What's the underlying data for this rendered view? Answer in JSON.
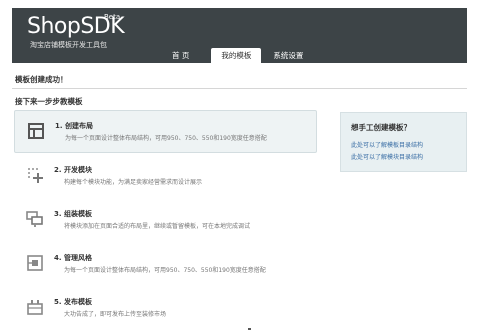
{
  "header": {
    "logo": "ShopSDK",
    "beta": "Beta",
    "tagline": "淘宝店铺模板开发工具包",
    "tabs": [
      {
        "label": "首 页"
      },
      {
        "label": "我的模板"
      },
      {
        "label": "系统设置"
      }
    ],
    "active_tab": "我的模板"
  },
  "main": {
    "success_message": "模板创建成功！",
    "next_steps_title": "接下来一步步教模板",
    "steps": [
      {
        "title": "1. 创建布局",
        "desc": "为每一个页面设计整体布局结构，可用950、750、550和190宽度任意搭配",
        "icon": "layout-icon"
      },
      {
        "title": "2. 开发模块",
        "desc": "构建每个模块功能，为满足卖家经营需求而设计展示",
        "icon": "add-module-icon"
      },
      {
        "title": "3. 组装模板",
        "desc": "将模块添加在页面合适的布局里，继续或暂留模板，可在本地完成调试",
        "icon": "assemble-icon"
      },
      {
        "title": "4. 管理风格",
        "desc": "为每一个页面设计整体布局结构，可用950、750、550和190宽度任意搭配",
        "icon": "style-icon"
      },
      {
        "title": "5. 发布模板",
        "desc": "大功告成了，即可发布上传至装修市场",
        "icon": "publish-icon"
      }
    ]
  },
  "help": {
    "title": "想手工创建模板？",
    "links": [
      "此处可以了解模板目录结构",
      "此处可以了解模块目录结构"
    ]
  },
  "colors": {
    "header_bg": "#3d4447",
    "highlight_bg": "#eef3f4",
    "help_bg": "#e8f0f2",
    "link": "#3a6ea5"
  }
}
